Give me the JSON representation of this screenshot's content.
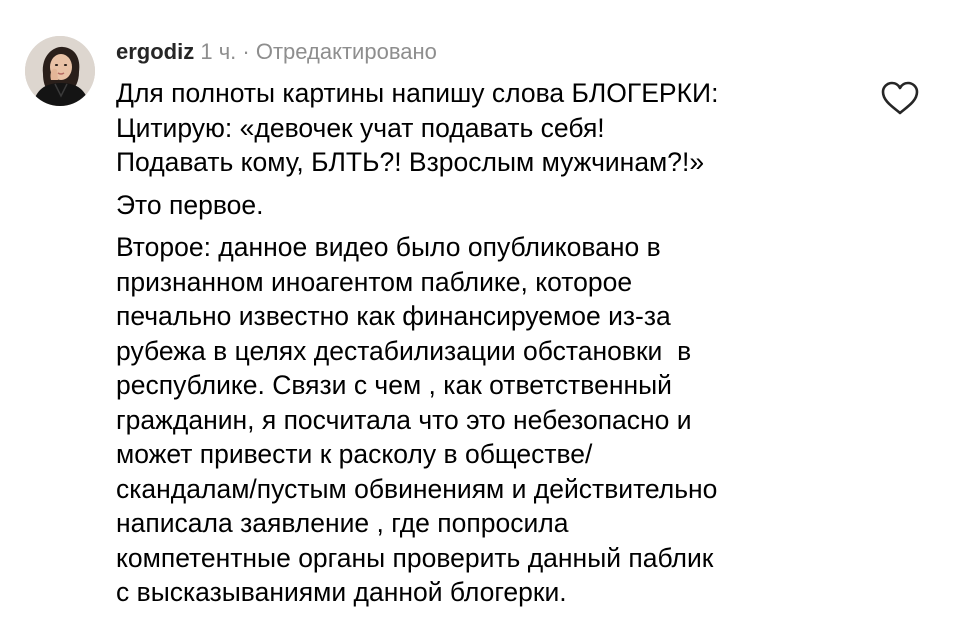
{
  "comment": {
    "username": "ergodiz",
    "time": "1 ч.",
    "separator": "·",
    "edited": "Отредактировано",
    "avatar_icon": "user-avatar-photo",
    "like_icon": "heart-outline-icon",
    "paragraphs": [
      {
        "lines": [
          "Для полноты картины напишу слова БЛОГЕРКИ:",
          "Цитирую: «девочек учат подавать себя!",
          "Подавать кому, БЛТЬ?! Взрослым мужчинам?!»"
        ]
      },
      {
        "lines": [
          "Это первое."
        ]
      },
      {
        "lines": [
          "Второе: данное видео было опубликовано в",
          "признанном иноагентом паблике, которое",
          "печально известно как финансируемое из-за",
          "рубежа в целях дестабилизации обстановки  в",
          "республике. Связи с чем , как ответственный",
          "гражданин, я посчитала что это небезопасно и",
          "может привести к расколу в обществе/",
          "скандалам/пустым обвинениям и действительно",
          "написала заявление , где попросила",
          "компетентные органы проверить данный паблик",
          "с высказываниями данной блогерки."
        ]
      }
    ]
  },
  "colors": {
    "text": "#000000",
    "username": "#262626",
    "muted": "#8e8e8e",
    "background": "#ffffff",
    "icon": "#262626"
  }
}
